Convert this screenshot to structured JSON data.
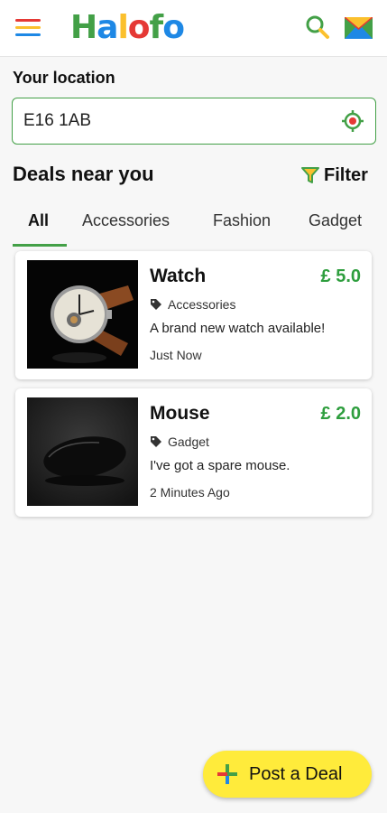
{
  "app": {
    "logo_letters": [
      {
        "ch": "H",
        "color": "#43a047"
      },
      {
        "ch": "a",
        "color": "#1e88e5"
      },
      {
        "ch": "l",
        "color": "#fbc02d"
      },
      {
        "ch": "o",
        "color": "#e53935"
      },
      {
        "ch": "f",
        "color": "#43a047"
      },
      {
        "ch": "o",
        "color": "#1e88e5"
      }
    ]
  },
  "colors": {
    "accent_green": "#43a047",
    "price_green": "#2e9e3e",
    "fab_yellow": "#ffeb3b"
  },
  "header": {
    "menu_icon": "hamburger-icon",
    "search_icon": "search-icon",
    "mail_icon": "mail-icon"
  },
  "location": {
    "label": "Your location",
    "value": "E16 1AB",
    "gps_icon": "gps-target-icon"
  },
  "deals": {
    "title": "Deals near you",
    "filter_label": "Filter"
  },
  "tabs": [
    {
      "label": "All",
      "active": true
    },
    {
      "label": "Accessories",
      "active": false
    },
    {
      "label": "Fashion",
      "active": false
    },
    {
      "label": "Gadget",
      "active": false
    }
  ],
  "listings": [
    {
      "title": "Watch",
      "price": "£ 5.0",
      "category": "Accessories",
      "description": "A brand new watch available!",
      "time": "Just Now",
      "image": "wristwatch-photo"
    },
    {
      "title": "Mouse",
      "price": "£ 2.0",
      "category": "Gadget",
      "description": "I've got a spare mouse.",
      "time": "2 Minutes Ago",
      "image": "computer-mouse-photo"
    }
  ],
  "fab": {
    "label": "Post a Deal",
    "icon": "plus-icon"
  }
}
